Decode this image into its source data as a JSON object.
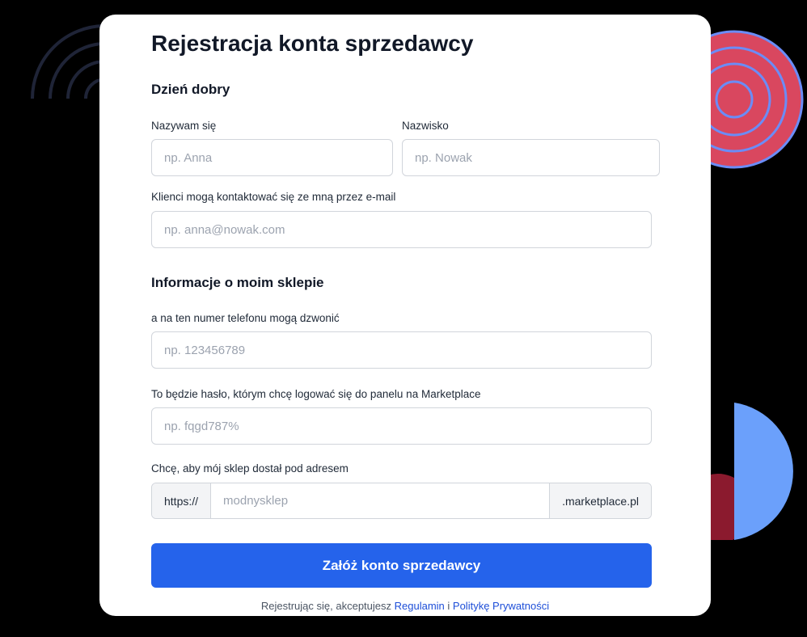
{
  "form": {
    "title": "Rejestracja konta sprzedawcy",
    "section_greeting": "Dzień dobry",
    "section_shop": "Informacje o moim sklepie",
    "first_name": {
      "label": "Nazywam się",
      "placeholder": "np. Anna",
      "value": ""
    },
    "last_name": {
      "label": "Nazwisko",
      "placeholder": "np. Nowak",
      "value": ""
    },
    "email": {
      "label": "Klienci mogą kontaktować się ze mną przez e-mail",
      "placeholder": "np. anna@nowak.com",
      "value": ""
    },
    "phone": {
      "label": "a na ten numer telefonu mogą dzwonić",
      "placeholder": "np. 123456789",
      "value": ""
    },
    "password": {
      "label": "To będzie hasło, którym chcę logować się do panelu na Marketplace",
      "placeholder": "np. fqgd787%",
      "value": ""
    },
    "shop_url": {
      "label": "Chcę, aby mój sklep dostał pod adresem",
      "prefix": "https://",
      "placeholder": "modnysklep",
      "suffix": ".marketplace.pl",
      "value": ""
    },
    "submit_label": "Załóż konto sprzedawcy",
    "terms": {
      "text_before": "Rejestrując się, akceptujesz ",
      "link_terms": "Regulamin",
      "text_between": " i ",
      "link_privacy": "Politykę Prywatności"
    }
  },
  "colors": {
    "background": "#000000",
    "card": "#ffffff",
    "primary_button": "#2563eb",
    "link": "#1d4ed8",
    "deco_pink": "#d9475f",
    "deco_ring": "#6b8cf7",
    "deco_blue": "#6ba0fb",
    "deco_darkred": "#8b1a2e"
  }
}
